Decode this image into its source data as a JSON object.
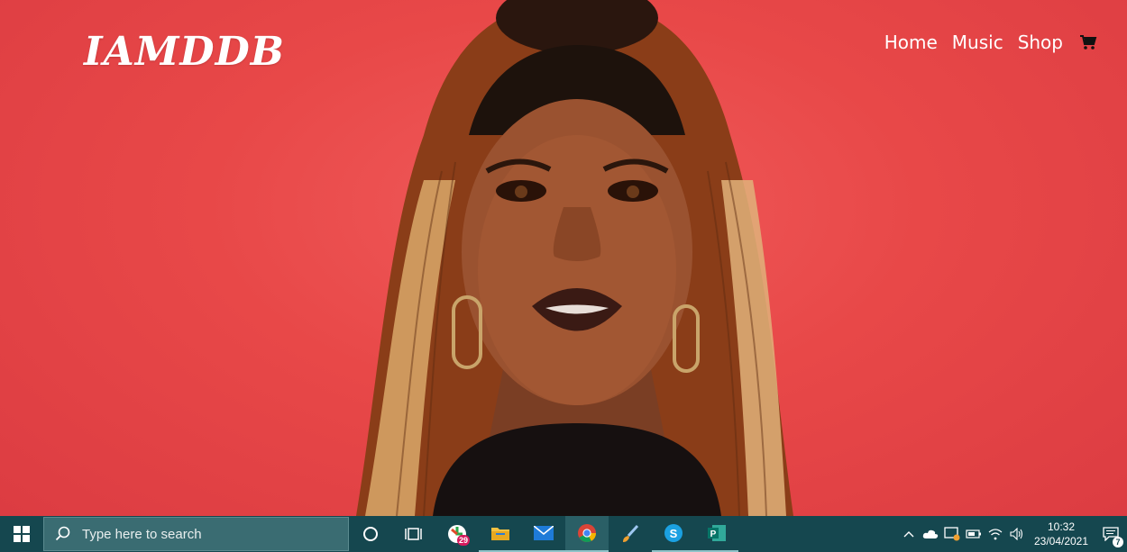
{
  "site": {
    "logo": "IAMDDB",
    "nav": [
      {
        "label": "Home"
      },
      {
        "label": "Music"
      },
      {
        "label": "Shop"
      }
    ]
  },
  "taskbar": {
    "search_placeholder": "Type here to search",
    "calendar_badge": "29",
    "apps": [
      "cortana-icon",
      "task-view-icon",
      "calendar-app-icon",
      "file-explorer-icon",
      "mail-icon",
      "chrome-icon",
      "paint-icon",
      "skype-icon",
      "publisher-icon"
    ],
    "clock": {
      "time": "10:32",
      "date": "23/04/2021"
    },
    "notification_count": "7"
  },
  "colors": {
    "hero_background": "#e84848",
    "taskbar_background": "#15474f",
    "taskbar_search": "#3a6c72"
  }
}
